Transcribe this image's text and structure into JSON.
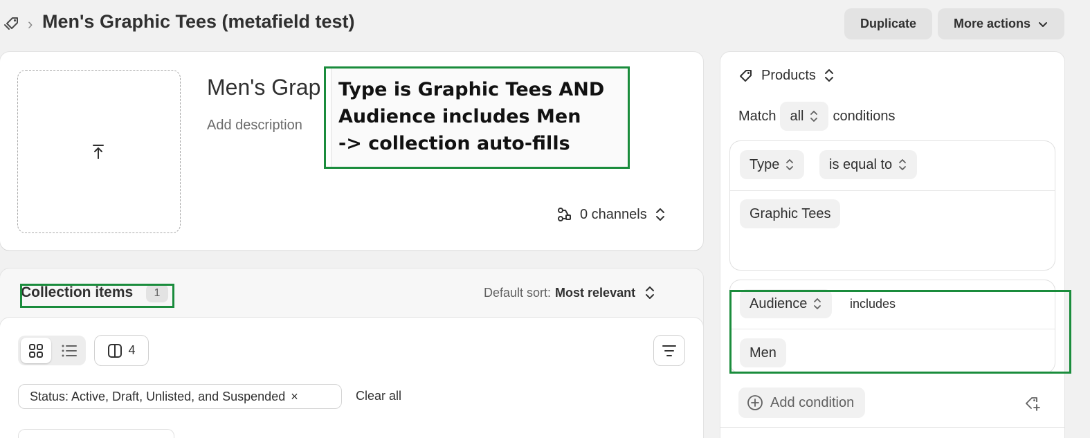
{
  "header": {
    "title": "Men's Graphic Tees (metafield test)",
    "duplicate_label": "Duplicate",
    "more_actions_label": "More actions"
  },
  "details": {
    "collection_name": "Men's Grap",
    "description_placeholder": "Add description",
    "channels_label": "0 channels"
  },
  "annotation": {
    "main_text": "Type is Graphic Tees AND\nAudience includes Men\n-> collection auto-fills",
    "color": "#1a8c3c"
  },
  "collection_items": {
    "title": "Collection items",
    "count": "1",
    "sort_prefix": "Default sort:",
    "sort_value": "Most relevant",
    "columns_count": "4",
    "status_filter": "Status: Active, Draft, Unlisted, and Suspended",
    "clear_all": "Clear all"
  },
  "conditions": {
    "scope_label": "Products",
    "match_prefix": "Match",
    "match_value": "all",
    "match_suffix": "conditions",
    "rule1": {
      "field": "Type",
      "operator": "is equal to",
      "value": "Graphic Tees"
    },
    "rule2": {
      "field": "Audience",
      "operator": "includes",
      "value": "Men"
    },
    "add_condition": "Add condition"
  }
}
